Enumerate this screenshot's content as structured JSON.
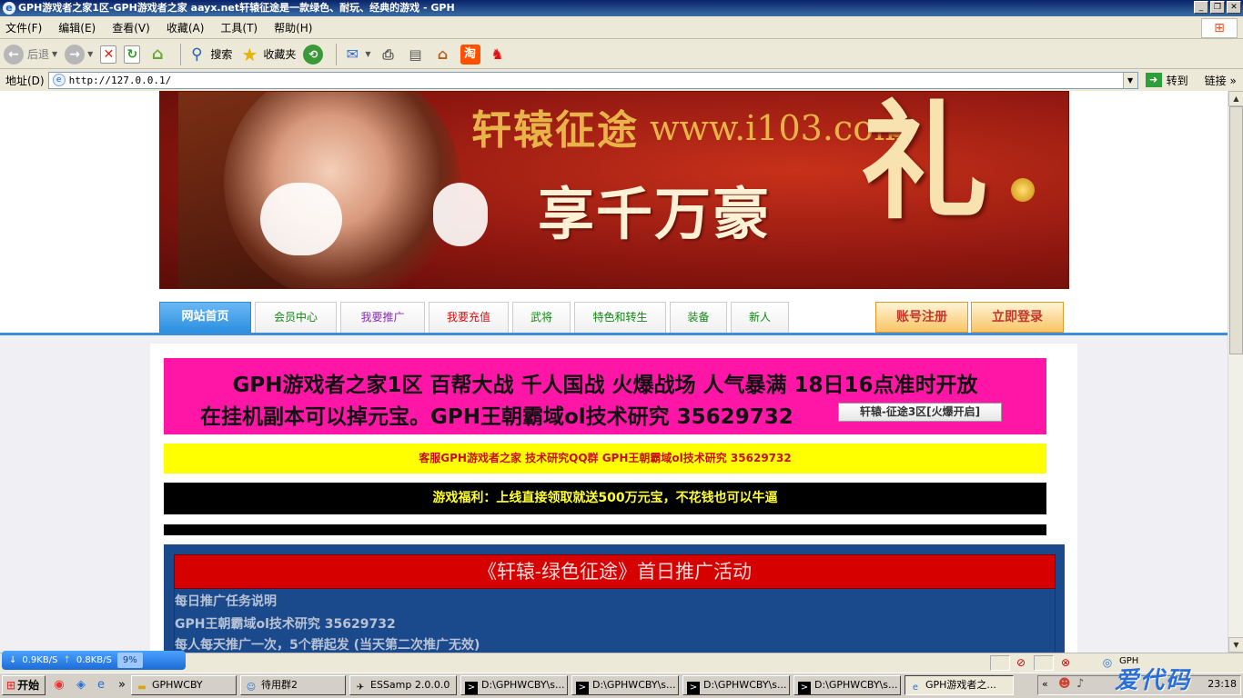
{
  "window": {
    "title": "GPH游戏者之家1区-GPH游戏者之家 aayx.net轩辕征途是一款绿色、耐玩、经典的游戏 - GPH"
  },
  "menu": {
    "items": [
      "文件(F)",
      "编辑(E)",
      "查看(V)",
      "收藏(A)",
      "工具(T)",
      "帮助(H)"
    ]
  },
  "toolbar": {
    "back_label": "后退",
    "search_label": "搜索",
    "favorites_label": "收藏夹"
  },
  "address": {
    "label": "地址(D)",
    "url": "http://127.0.0.1/",
    "go_label": "转到",
    "links_label": "链接"
  },
  "banner": {
    "title": "轩辕征途",
    "site": "www.i103.com",
    "slogan": "享千万豪",
    "slogan_char": "礼"
  },
  "nav": {
    "tabs": [
      {
        "label": "网站首页",
        "color": "#ffffff"
      },
      {
        "label": "会员中心",
        "color": "#118811"
      },
      {
        "label": "我要推广",
        "color": "#8b2bb5"
      },
      {
        "label": "我要充值",
        "color": "#cc1111"
      },
      {
        "label": "武将",
        "color": "#118811"
      },
      {
        "label": "特色和转生",
        "color": "#118811"
      },
      {
        "label": "装备",
        "color": "#118811"
      },
      {
        "label": "新人",
        "color": "#118811"
      }
    ],
    "register_label": "账号注册",
    "login_label": "立即登录"
  },
  "announce": {
    "line1": "GPH游戏者之家1区  百帮大战  千人国战  火爆战场  人气暴满  18日16点准时开放",
    "line2": "在挂机副本可以掉元宝。GPH王朝霸域ol技术研究  35629732",
    "server_button": "轩辕-征途3区[火爆开启]",
    "yellow": "客服GPH游戏者之家  技术研究QQ群  GPH王朝霸域ol技术研究  35629732",
    "black": "游戏福利：上线直接领取就送500万元宝，不花钱也可以牛逼"
  },
  "promo": {
    "title": "《轩辕-绿色征途》首日推广活动",
    "lines": [
      "每日推广任务说明",
      "GPH王朝霸域ol技术研究  35629732",
      "每人每天推广一次，5个群起发 (当天第二次推广无效)"
    ]
  },
  "status": {
    "down": "0.9KB/S",
    "up": "0.8KB/S",
    "percent": "9%",
    "zone": "GPH"
  },
  "taskbar": {
    "start_label": "开始",
    "tasks": [
      "GPHWCBY",
      "待用群2",
      "ESSamp 2.0.0.0",
      "D:\\GPHWCBY\\s...",
      "D:\\GPHWCBY\\s...",
      "D:\\GPHWCBY\\s...",
      "D:\\GPHWCBY\\s...",
      "GPH游戏者之..."
    ],
    "clock": "23:18",
    "watermark": "爱代码"
  }
}
